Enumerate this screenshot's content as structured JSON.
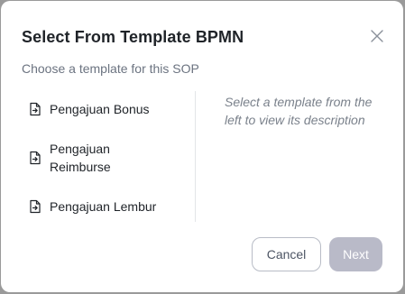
{
  "dialog": {
    "title": "Select From Template BPMN",
    "subtitle": "Choose a template for this SOP",
    "close_icon": "close-icon"
  },
  "templates": [
    {
      "label": "Pengajuan Bonus",
      "icon": "document-arrow-icon"
    },
    {
      "label": "Pengajuan Reimburse",
      "icon": "document-arrow-icon"
    },
    {
      "label": "Pengajuan Lembur",
      "icon": "document-arrow-icon"
    }
  ],
  "description_placeholder": "Select a template from the left to view its description",
  "footer": {
    "cancel_label": "Cancel",
    "next_label": "Next"
  },
  "colors": {
    "next_disabled_bg": "#b9bac8",
    "cancel_border": "#b8bcc6",
    "overlay": "#9a9a9a"
  }
}
